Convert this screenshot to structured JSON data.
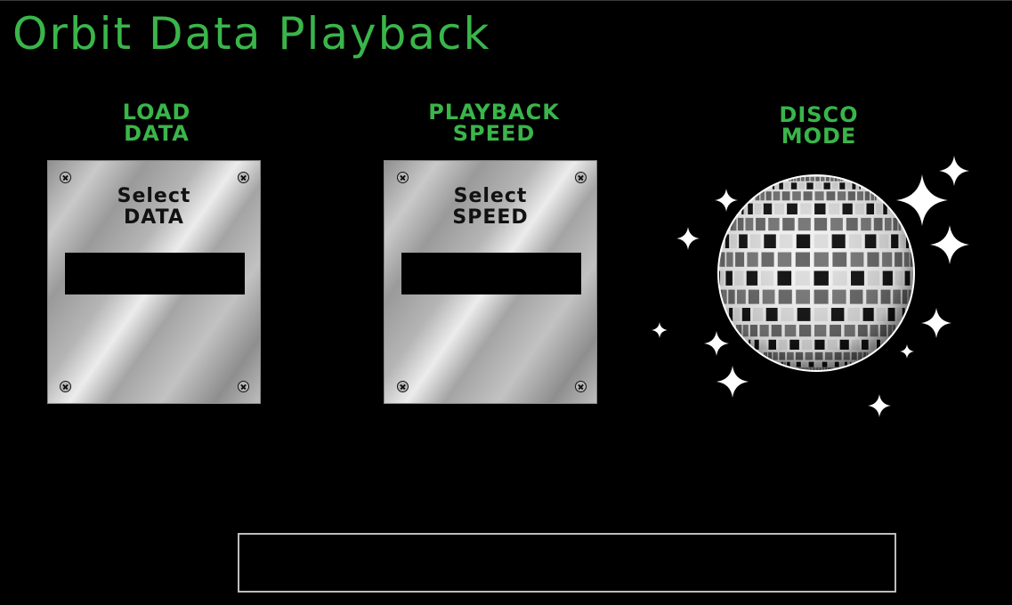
{
  "app": {
    "title": "Orbit Data Playback"
  },
  "panels": {
    "load": {
      "heading_line1": "LOAD",
      "heading_line2": "DATA",
      "label_line1": "Select",
      "label_line2": "DATA",
      "slot_value": ""
    },
    "speed": {
      "heading_line1": "PLAYBACK",
      "heading_line2": "SPEED",
      "label_line1": "Select",
      "label_line2": "SPEED",
      "slot_value": ""
    },
    "disco": {
      "heading_line1": "DISCO",
      "heading_line2": "MODE",
      "icon": "disco-ball-icon"
    }
  },
  "status": {
    "text": ""
  },
  "colors": {
    "background": "#000000",
    "accent_green": "#3ab54a",
    "plate_silver": "#c0c0c0",
    "status_border": "#bdbdbd"
  }
}
